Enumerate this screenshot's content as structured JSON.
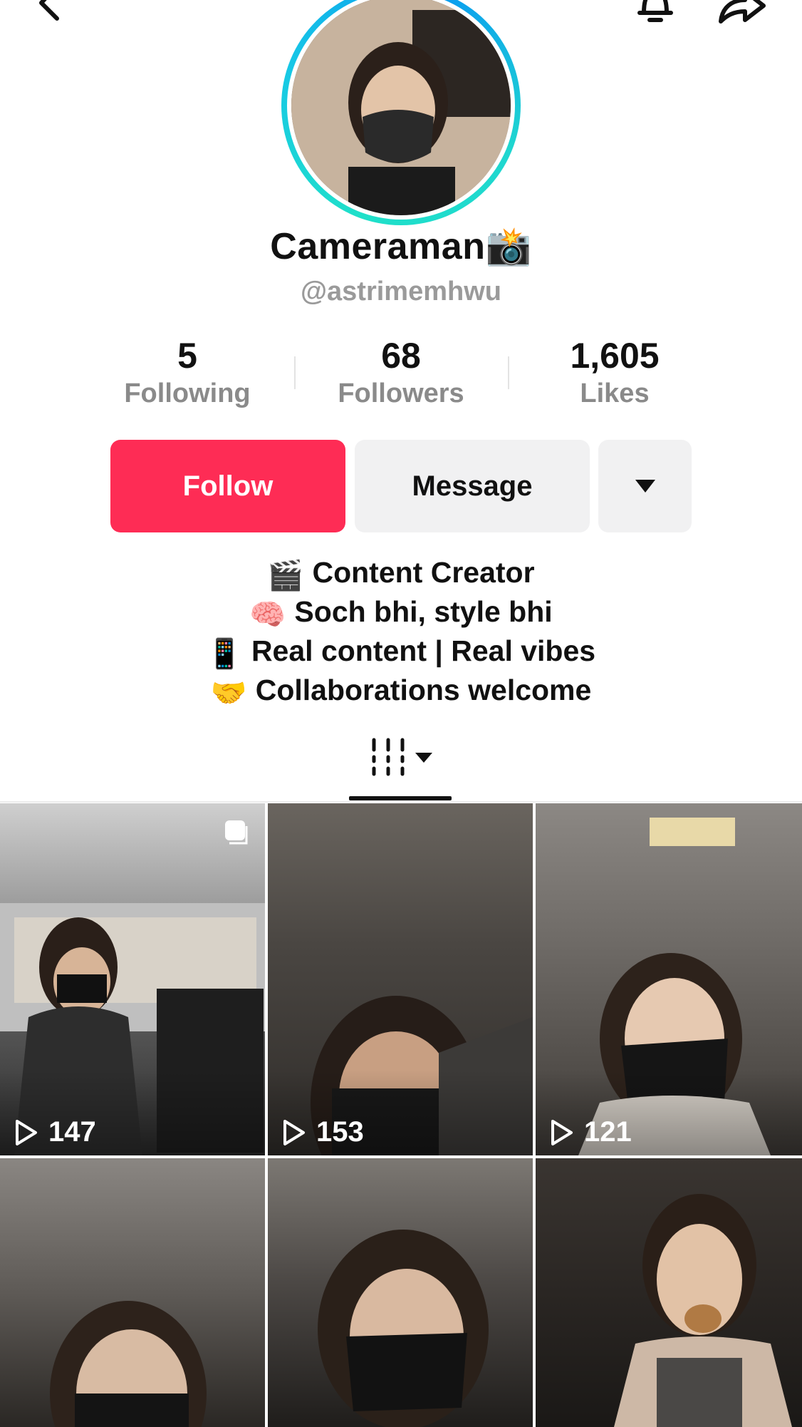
{
  "profile": {
    "name": "Cameraman📸",
    "handle": "@astrimemhwu"
  },
  "stats": {
    "following": {
      "value": "5",
      "label": "Following"
    },
    "followers": {
      "value": "68",
      "label": "Followers"
    },
    "likes": {
      "value": "1,605",
      "label": "Likes"
    }
  },
  "actions": {
    "follow": "Follow",
    "message": "Message"
  },
  "bio": [
    {
      "emoji": "🎬",
      "text": "Content Creator"
    },
    {
      "emoji": "🧠",
      "text": "Soch bhi, style bhi"
    },
    {
      "emoji": "📱",
      "text": "Real content | Real vibes"
    },
    {
      "emoji": "🤝",
      "text": "Collaborations welcome"
    }
  ],
  "videos": [
    {
      "views": "147"
    },
    {
      "views": "153"
    },
    {
      "views": "121"
    },
    {
      "views": ""
    },
    {
      "views": ""
    },
    {
      "views": ""
    }
  ],
  "colors": {
    "follow": "#fe2c55",
    "ring_start": "#1fe0c9",
    "ring_end": "#0a9cf0"
  }
}
